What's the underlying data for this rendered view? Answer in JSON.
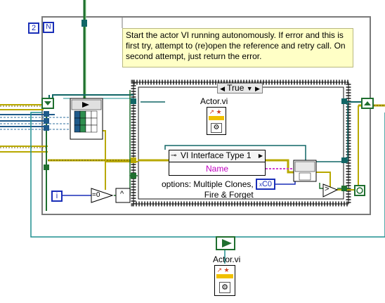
{
  "iteration_constant": "2",
  "no_terminal": "N",
  "comment_text": "Start the actor VI running autonomously. If error and this is first try, attempt to (re)open the reference and retry call. On second attempt, just return the error.",
  "case_selector": "True",
  "actor_vi_label_inner": "Actor.vi",
  "actor_vi_label_bottom": "Actor.vi",
  "property_node_class": "VI Interface Type 1",
  "property_node_property": "Name",
  "options_label": "options: Multiple Clones,\nFire & Forget",
  "hex_constant": "C0",
  "hex_prefix": "x",
  "iteration_terminal": "i",
  "compare_zero": "=0",
  "and_symbol": "^",
  "greater_symbol": ">"
}
